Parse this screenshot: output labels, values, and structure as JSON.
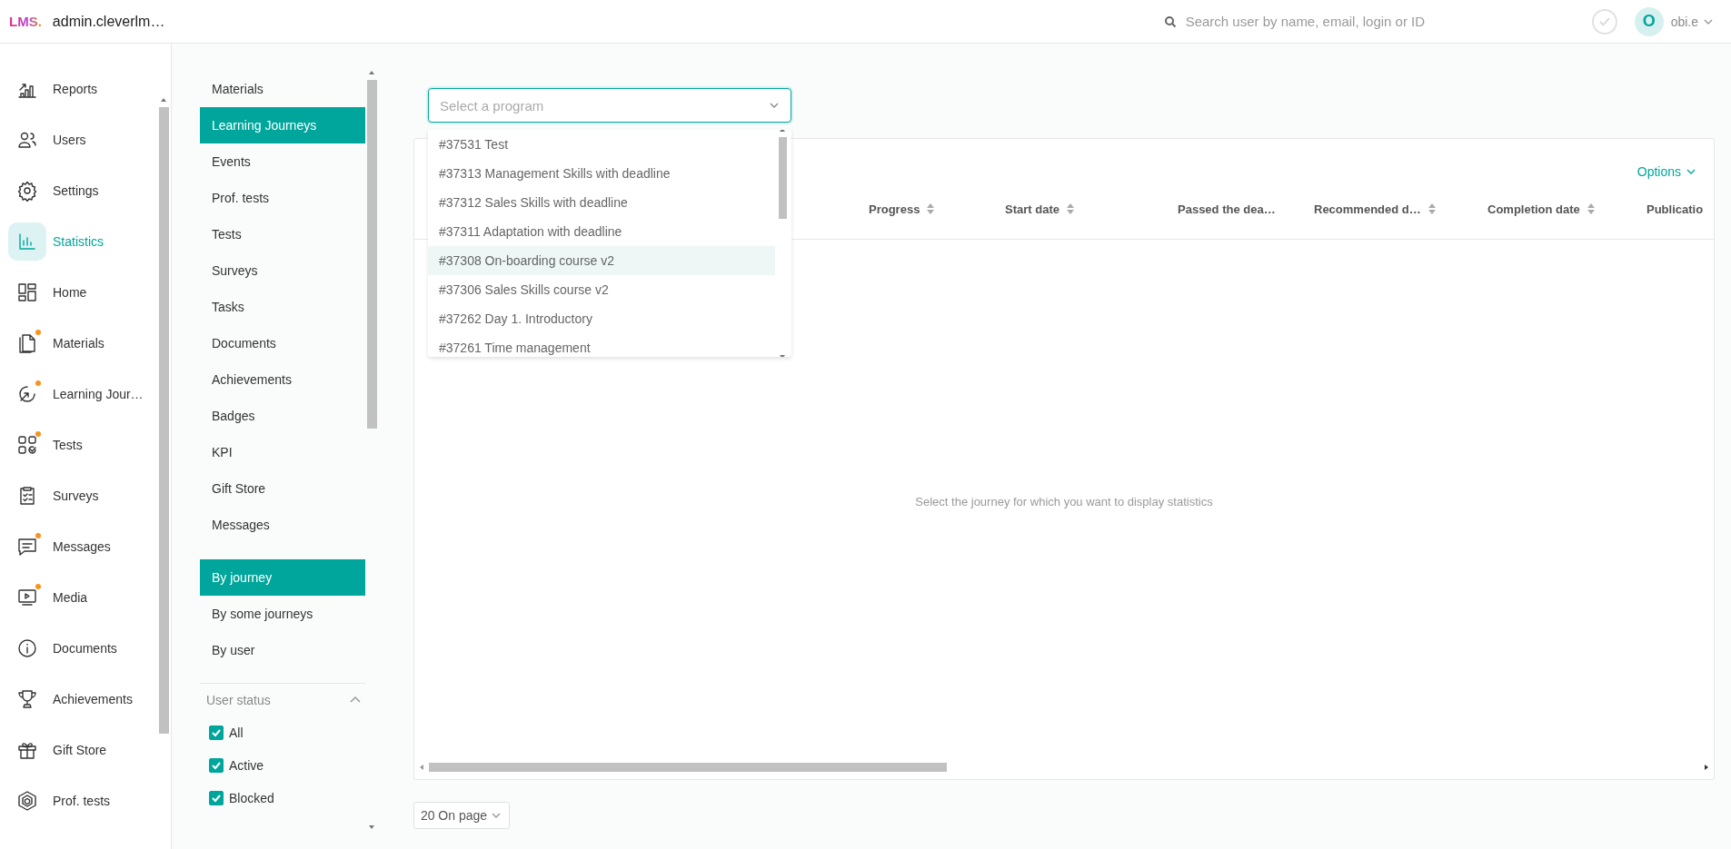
{
  "header": {
    "logo": "LMS.",
    "site": "admin.cleverlm…",
    "search": {
      "placeholder": "Search user by name, email, login or ID"
    },
    "user": {
      "initial": "O",
      "name": "obi.e"
    }
  },
  "nav": [
    {
      "label": "Reports",
      "selected": false,
      "badge": false
    },
    {
      "label": "Users",
      "selected": false,
      "badge": false
    },
    {
      "label": "Settings",
      "selected": false,
      "badge": false
    },
    {
      "label": "Statistics",
      "selected": true,
      "badge": false
    },
    {
      "label": "Home",
      "selected": false,
      "badge": false
    },
    {
      "label": "Materials",
      "selected": false,
      "badge": true
    },
    {
      "label": "Learning Jour…",
      "selected": false,
      "badge": true
    },
    {
      "label": "Tests",
      "selected": false,
      "badge": true
    },
    {
      "label": "Surveys",
      "selected": false,
      "badge": false
    },
    {
      "label": "Messages",
      "selected": false,
      "badge": true
    },
    {
      "label": "Media",
      "selected": false,
      "badge": true
    },
    {
      "label": "Documents",
      "selected": false,
      "badge": false
    },
    {
      "label": "Achievements",
      "selected": false,
      "badge": false
    },
    {
      "label": "Gift Store",
      "selected": false,
      "badge": false
    },
    {
      "label": "Prof. tests",
      "selected": false,
      "badge": false
    }
  ],
  "sections": [
    {
      "label": "Materials",
      "selected": false
    },
    {
      "label": "Learning Journeys",
      "selected": true
    },
    {
      "label": "Events",
      "selected": false
    },
    {
      "label": "Prof. tests",
      "selected": false
    },
    {
      "label": "Tests",
      "selected": false
    },
    {
      "label": "Surveys",
      "selected": false
    },
    {
      "label": "Tasks",
      "selected": false
    },
    {
      "label": "Documents",
      "selected": false
    },
    {
      "label": "Achievements",
      "selected": false
    },
    {
      "label": "Badges",
      "selected": false
    },
    {
      "label": "KPI",
      "selected": false
    },
    {
      "label": "Gift Store",
      "selected": false
    },
    {
      "label": "Messages",
      "selected": false
    }
  ],
  "report_types": [
    {
      "label": "By journey",
      "selected": true
    },
    {
      "label": "By some journeys",
      "selected": false
    },
    {
      "label": "By user",
      "selected": false
    }
  ],
  "user_status": {
    "title": "User status",
    "expanded": true,
    "options": [
      {
        "label": "All",
        "checked": true
      },
      {
        "label": "Active",
        "checked": true
      },
      {
        "label": "Blocked",
        "checked": true
      }
    ]
  },
  "program_select": {
    "placeholder": "Select a program",
    "expanded": true,
    "options": [
      {
        "label": "#37531 Test",
        "highlighted": false
      },
      {
        "label": "#37313 Management Skills with deadline",
        "highlighted": false
      },
      {
        "label": "#37312 Sales Skills with deadline",
        "highlighted": false
      },
      {
        "label": "#37311 Adaptation with deadline",
        "highlighted": false
      },
      {
        "label": "#37308 On-boarding course v2",
        "highlighted": true
      },
      {
        "label": "#37306 Sales Skills course v2",
        "highlighted": false
      },
      {
        "label": "#37262 Day 1. Introductory",
        "highlighted": false
      },
      {
        "label": "#37261 Time management",
        "highlighted": false
      }
    ]
  },
  "table": {
    "options_label": "Options",
    "columns": [
      {
        "label": "Progress",
        "sortable": true
      },
      {
        "label": "Start date",
        "sortable": true
      },
      {
        "label": "Passed the dea…",
        "sortable": false
      },
      {
        "label": "Recommended d…",
        "sortable": true
      },
      {
        "label": "Completion date",
        "sortable": true
      },
      {
        "label": "Publicatio",
        "sortable": false
      }
    ],
    "empty_message": "Select the journey for which you want to display statistics"
  },
  "pagination": {
    "page_size": "20 On page"
  }
}
